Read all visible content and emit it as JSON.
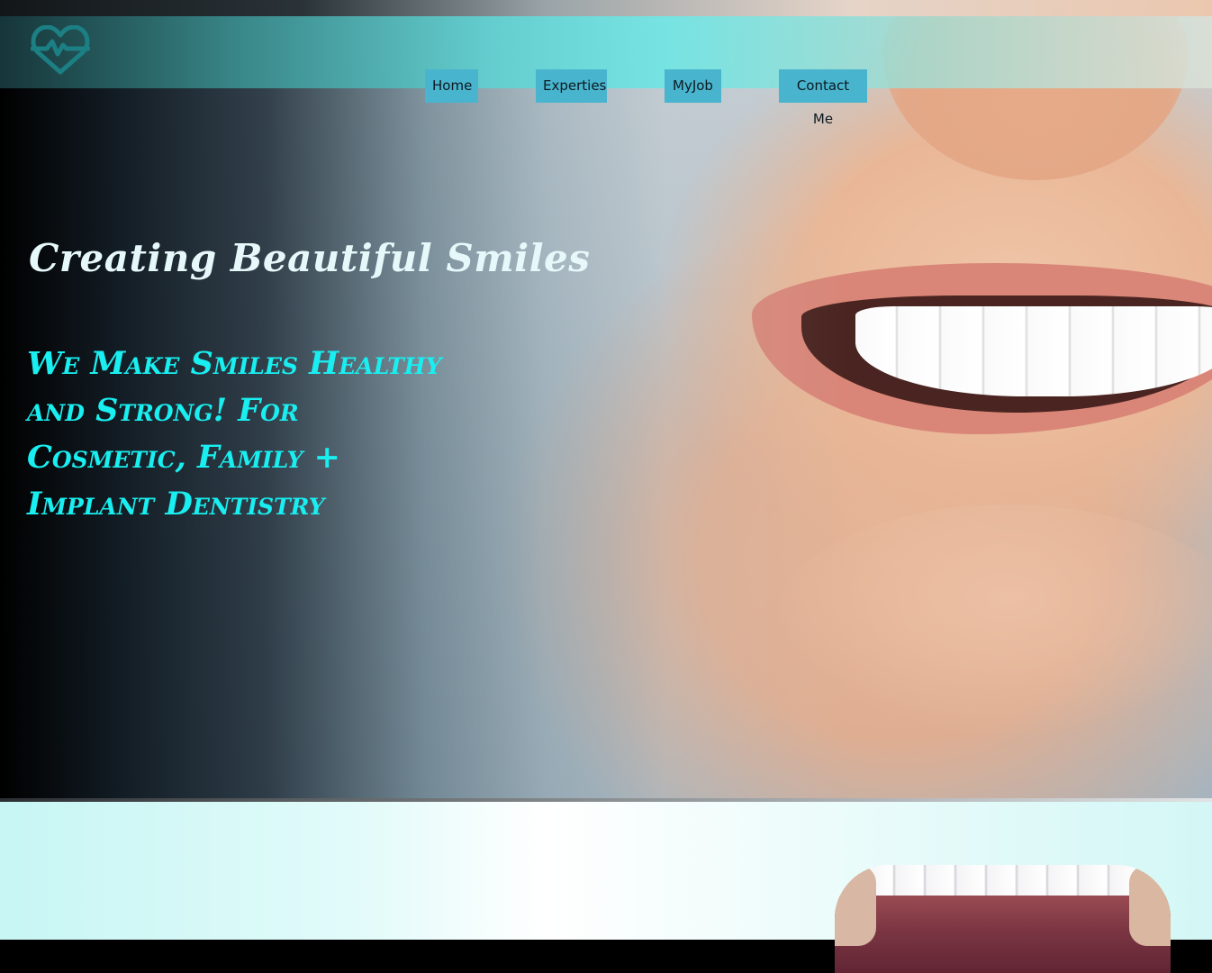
{
  "brand": {
    "logo_icon": "heart-pulse-icon",
    "accent_color": "#19eef0",
    "nav_bg_color": "#49b4cd"
  },
  "nav": {
    "items": [
      {
        "label": "Home"
      },
      {
        "label": "Experties"
      },
      {
        "label": "MyJob"
      },
      {
        "label": "Contact Me"
      }
    ]
  },
  "hero": {
    "title": "Creating Beautiful Smiles",
    "subtitle": "We Make Smiles Healthy and Strong! For Cosmetic, Family + Implant Dentistry",
    "image": "smile-photo"
  },
  "section2": {
    "image": "dental-photo"
  }
}
